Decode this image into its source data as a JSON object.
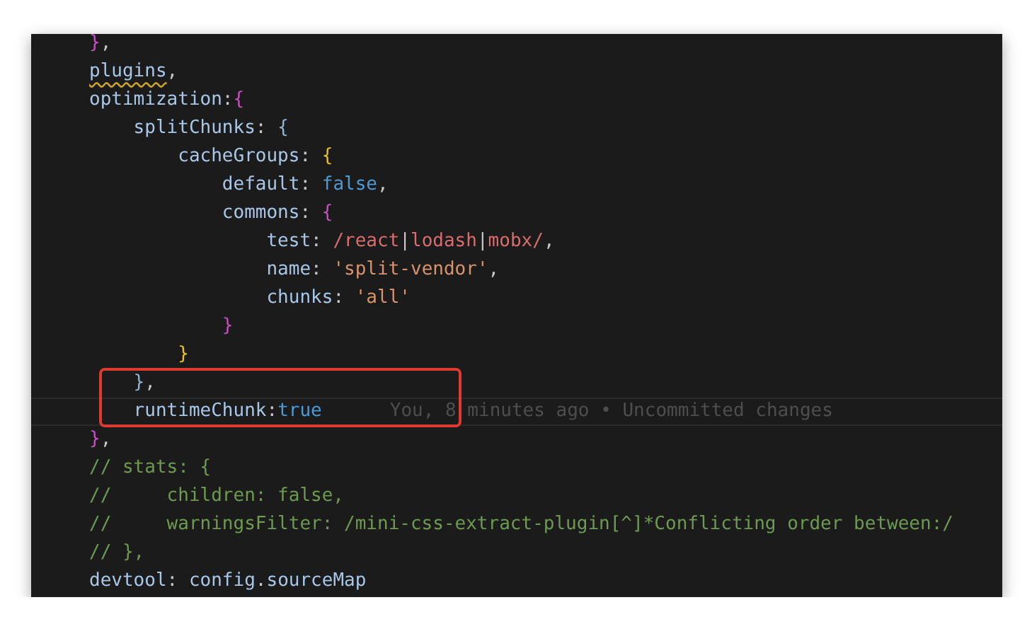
{
  "editor": {
    "lines": [
      {
        "tokens": [
          {
            "text": "}",
            "kind": "brace_purple"
          },
          {
            "text": ",",
            "kind": "punct"
          }
        ]
      },
      {
        "tokens": [
          {
            "text": "plugins",
            "kind": "key",
            "squiggle": true
          },
          {
            "text": ",",
            "kind": "punct"
          }
        ]
      },
      {
        "tokens": [
          {
            "text": "optimization",
            "kind": "key"
          },
          {
            "text": ":",
            "kind": "punct"
          },
          {
            "text": "{",
            "kind": "brace_purple"
          }
        ]
      },
      {
        "tokens": [
          {
            "text": "    splitChunks",
            "kind": "key"
          },
          {
            "text": ": ",
            "kind": "punct"
          },
          {
            "text": "{",
            "kind": "brace_blue"
          }
        ]
      },
      {
        "tokens": [
          {
            "text": "        cacheGroups",
            "kind": "key"
          },
          {
            "text": ": ",
            "kind": "punct"
          },
          {
            "text": "{",
            "kind": "brace_yellow"
          }
        ]
      },
      {
        "tokens": [
          {
            "text": "            default",
            "kind": "key"
          },
          {
            "text": ": ",
            "kind": "punct"
          },
          {
            "text": "false",
            "kind": "bool"
          },
          {
            "text": ",",
            "kind": "punct"
          }
        ]
      },
      {
        "tokens": [
          {
            "text": "            commons",
            "kind": "key"
          },
          {
            "text": ": ",
            "kind": "punct"
          },
          {
            "text": "{",
            "kind": "brace_purple"
          }
        ]
      },
      {
        "tokens": [
          {
            "text": "                test",
            "kind": "key"
          },
          {
            "text": ": ",
            "kind": "punct"
          },
          {
            "text": "/react",
            "kind": "regex"
          },
          {
            "text": "|",
            "kind": "punct"
          },
          {
            "text": "lodash",
            "kind": "regex"
          },
          {
            "text": "|",
            "kind": "punct"
          },
          {
            "text": "mobx/",
            "kind": "regex"
          },
          {
            "text": ",",
            "kind": "punct"
          }
        ]
      },
      {
        "tokens": [
          {
            "text": "                name",
            "kind": "key"
          },
          {
            "text": ": ",
            "kind": "punct"
          },
          {
            "text": "'split-vendor'",
            "kind": "string"
          },
          {
            "text": ",",
            "kind": "punct"
          }
        ]
      },
      {
        "tokens": [
          {
            "text": "                chunks",
            "kind": "key"
          },
          {
            "text": ": ",
            "kind": "punct"
          },
          {
            "text": "'all'",
            "kind": "string"
          }
        ]
      },
      {
        "tokens": [
          {
            "text": "            }",
            "kind": "brace_purple"
          }
        ]
      },
      {
        "tokens": [
          {
            "text": "        }",
            "kind": "brace_yellow"
          }
        ]
      },
      {
        "boxed": true,
        "tokens": [
          {
            "text": "    }",
            "kind": "brace_blue"
          },
          {
            "text": ",",
            "kind": "punct"
          }
        ]
      },
      {
        "boxed": true,
        "current": true,
        "blame": "You, 8 minutes ago • Uncommitted changes",
        "tokens": [
          {
            "text": "    runtimeChunk",
            "kind": "key"
          },
          {
            "text": ":",
            "kind": "punct"
          },
          {
            "text": "true",
            "kind": "bool"
          }
        ]
      },
      {
        "tokens": [
          {
            "text": "}",
            "kind": "brace_purple"
          },
          {
            "text": ",",
            "kind": "punct"
          }
        ]
      },
      {
        "tokens": [
          {
            "text": "// stats: {",
            "kind": "comment"
          }
        ]
      },
      {
        "tokens": [
          {
            "text": "//     children: false,",
            "kind": "comment"
          }
        ]
      },
      {
        "tokens": [
          {
            "text": "//     warningsFilter: /mini-css-extract-plugin[^]*Conflicting order between:/",
            "kind": "comment"
          }
        ]
      },
      {
        "tokens": [
          {
            "text": "// },",
            "kind": "comment"
          }
        ]
      },
      {
        "tokens": [
          {
            "text": "devtool",
            "kind": "key"
          },
          {
            "text": ": ",
            "kind": "punct"
          },
          {
            "text": "config",
            "kind": "key"
          },
          {
            "text": ".",
            "kind": "punct"
          },
          {
            "text": "sourceMap",
            "kind": "key"
          }
        ]
      }
    ]
  }
}
